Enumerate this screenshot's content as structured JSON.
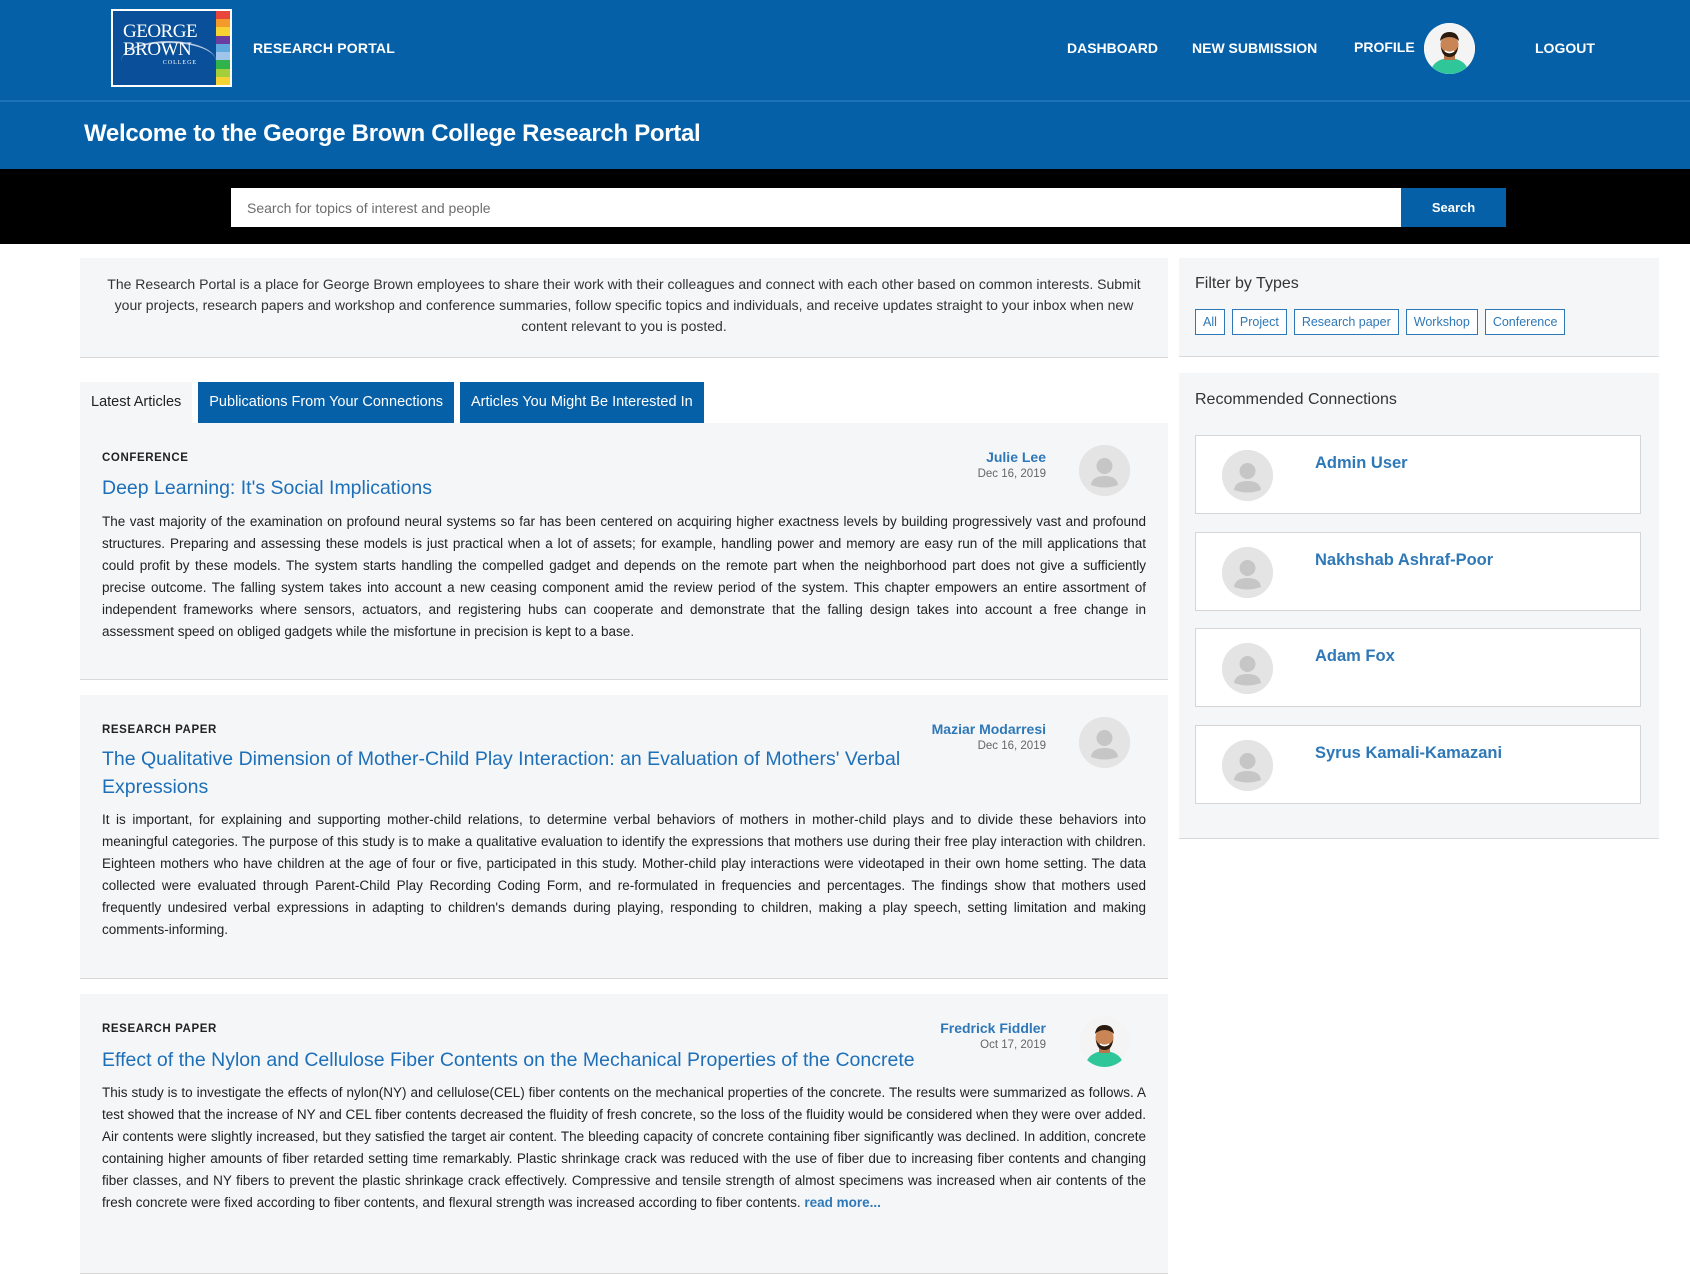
{
  "nav": {
    "logo_line1": "GEORGE",
    "logo_line2": "BROWN",
    "logo_line3": "COLLEGE",
    "portal_title": "RESEARCH PORTAL",
    "links": {
      "dashboard": "DASHBOARD",
      "new_submission": "NEW SUBMISSION",
      "profile": "PROFILE",
      "logout": "LOGOUT"
    }
  },
  "welcome": {
    "heading": "Welcome to the George Brown College Research Portal"
  },
  "search": {
    "placeholder": "Search for topics of interest and people",
    "button_label": "Search"
  },
  "intro": {
    "text": "The Research Portal is a place for George Brown employees to share their work with their colleagues and connect with each other based on common interests. Submit your projects, research papers and workshop and conference summaries, follow specific topics and individuals, and receive updates straight to your inbox when new content relevant to you is posted."
  },
  "tabs": [
    {
      "label": "Latest Articles",
      "active": true
    },
    {
      "label": "Publications From Your Connections",
      "active": false
    },
    {
      "label": "Articles You Might Be Interested In",
      "active": false
    }
  ],
  "articles": [
    {
      "type": "CONFERENCE",
      "title": "Deep Learning: It's Social Implications",
      "author": "Julie Lee",
      "date": "Dec 16, 2019",
      "avatar": "default-avatar-icon",
      "abstract": "The vast majority of the examination on profound neural systems so far has been centered on acquiring higher exactness levels by building progressively vast and profound structures. Preparing and assessing these models is just practical when a lot of assets; for example, handling power and memory are easy run of the mill applications that could profit by these models. The system starts handling the compelled gadget and depends on the remote part when the neighborhood part does not give a sufficiently precise outcome. The falling system takes into account a new ceasing component amid the review period of the system. This chapter empowers an entire assortment of independent frameworks where sensors, actuators, and registering hubs can cooperate and demonstrate that the falling design takes into account a free change in assessment speed on obliged gadgets while the misfortune in precision is kept to a base."
    },
    {
      "type": "RESEARCH PAPER",
      "title": "The Qualitative Dimension of Mother-Child Play Interaction: an Evaluation of Mothers' Verbal Expressions",
      "author": "Maziar Modarresi",
      "date": "Dec 16, 2019",
      "avatar": "default-avatar-icon",
      "abstract": "It is important, for explaining and supporting mother-child relations, to determine verbal behaviors of mothers in mother-child plays and to divide these behaviors into meaningful categories. The purpose of this study is to make a qualitative evaluation to identify the expressions that mothers use during their free play interaction with children. Eighteen mothers who have children at the age of four or five, participated in this study. Mother-child play interactions were videotaped in their own home setting. The data collected were evaluated through Parent-Child Play Recording Coding Form, and re-formulated in frequencies and percentages. The findings show that mothers used frequently undesired verbal expressions in adapting to children's demands during playing, responding to children, making a play speech, setting limitation and making comments-informing."
    },
    {
      "type": "RESEARCH PAPER",
      "title": "Effect of the Nylon and Cellulose Fiber Contents on the Mechanical Properties of the Concrete",
      "author": "Fredrick Fiddler",
      "date": "Oct 17, 2019",
      "avatar": "photo-avatar",
      "abstract": "This study is to investigate the effects of nylon(NY) and cellulose(CEL) fiber contents on the mechanical properties of the concrete. The results were summarized as follows. A test showed that the increase of NY and CEL fiber contents decreased the fluidity of fresh concrete, so the loss of the fluidity would be considered when they were over added. Air contents were slightly increased, but they satisfied the target air content. The bleeding capacity of concrete containing fiber significantly was declined. In addition, concrete containing higher amounts of fiber retarded setting time remarkably. Plastic shrinkage crack was reduced with the use of fiber due to increasing fiber contents and changing fiber classes, and NY fibers to prevent the plastic shrinkage crack effectively. Compressive and tensile strength of almost specimens was increased when air contents of the fresh concrete were fixed according to fiber contents, and flexural strength was increased according to fiber contents.",
      "read_more": "read more..."
    }
  ],
  "filter": {
    "title": "Filter by Types",
    "types": [
      "All",
      "Project",
      "Research paper",
      "Workshop",
      "Conference"
    ]
  },
  "connections": {
    "title": "Recommended Connections",
    "people": [
      "Admin User",
      "Nakhshab Ashraf-Poor",
      "Adam Fox",
      "Syrus Kamali-Kamazani"
    ]
  },
  "colors": {
    "brand_blue": "#0560a8",
    "link_blue": "#2e78b8",
    "title_blue": "#1d6fb8",
    "panel_bg": "#f5f6f8",
    "logo_bars": [
      "#e8453c",
      "#f39a2b",
      "#f7d233",
      "#6a3ea1",
      "#5fa9dd",
      "#9fc5ea",
      "#2fb34a",
      "#a3cf3a",
      "#f7d233"
    ]
  }
}
